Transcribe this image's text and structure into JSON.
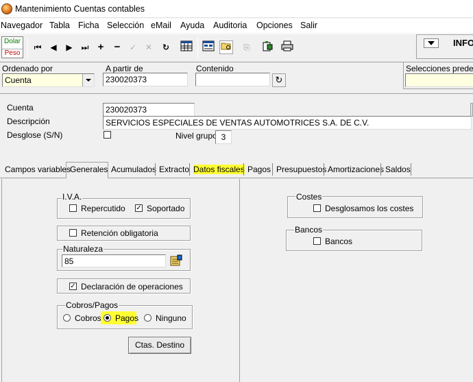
{
  "window": {
    "title": "Mantenimiento Cuentas contables"
  },
  "menu": [
    "Navegador",
    "Tabla",
    "Ficha",
    "Selección",
    "eMail",
    "Ayuda",
    "Auditoria",
    "Opciones",
    "Salir"
  ],
  "toolbar": {
    "dolar": "Dolar",
    "peso": "Peso",
    "info_label": "INFO"
  },
  "filter": {
    "ordenado_por_label": "Ordenado por",
    "ordenado_por_value": "Cuenta",
    "a_partir_de_label": "A partir de",
    "a_partir_de_value": "230020373",
    "contenido_label": "Contenido",
    "contenido_value": "",
    "selecciones_label": "Selecciones predefin"
  },
  "record": {
    "cuenta_label": "Cuenta",
    "cuenta_value": "230020373",
    "descripcion_label": "Descripción",
    "descripcion_value": "SERVICIOS ESPECIALES DE VENTAS AUTOMOTRICES S.A. DE C.V.",
    "desglose_label": "Desglose (S/N)",
    "nivel_grupo_label": "Nivel grupo",
    "nivel_grupo_value": "3"
  },
  "tabs": [
    "Campos variables",
    "Generales",
    "Acumulados",
    "Extracto",
    "Datos fiscales",
    "Pagos",
    "Presupuestos",
    "Amortizaciones",
    "Saldos"
  ],
  "active_tab": "Generales",
  "highlighted_tab": "Datos fiscales",
  "generales": {
    "iva_title": "I.V.A.",
    "repercutido": "Repercutido",
    "repercutido_checked": false,
    "soportado": "Soportado",
    "soportado_checked": true,
    "retencion": "Retención obligatoria",
    "retencion_checked": false,
    "naturaleza_title": "Naturaleza",
    "naturaleza_value": "85",
    "declaracion": "Declaración de operaciones",
    "declaracion_checked": true,
    "cobros_pagos_title": "Cobros/Pagos",
    "cobros": "Cobros",
    "pagos": "Pagos",
    "ninguno": "Ninguno",
    "selected_option": "Pagos",
    "ctas_destino": "Ctas. Destino",
    "costes_title": "Costes",
    "desglosamos": "Desglosamos los costes",
    "desglosamos_checked": false,
    "bancos_title": "Bancos",
    "bancos": "Bancos",
    "bancos_checked": false
  },
  "colors": {
    "highlight": "#ffff33",
    "combo_bg": "#ffffe1",
    "dolar": "#007a00",
    "peso": "#c00000"
  }
}
